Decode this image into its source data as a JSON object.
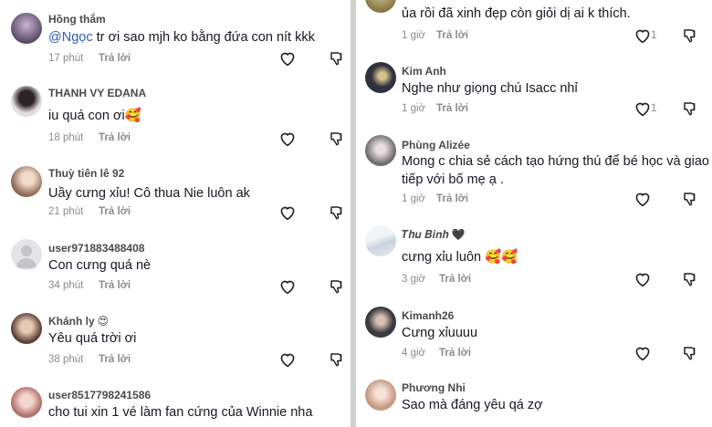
{
  "left_comments": [
    {
      "username": "Hồng thắm",
      "mention": "@Ngọc",
      "text": " tr ơi sao mjh ko bằng đứa con nít kkk",
      "time": "17 phút",
      "reply": "Trả lời",
      "avatar_color": "#5b4a6a"
    },
    {
      "username": "THANH VY EDANA",
      "text": "iu quá con ơi🥰",
      "time": "18 phút",
      "reply": "Trả lời",
      "avatar_color": "#d9d3da"
    },
    {
      "username": "Thuỳ tiên lê 92",
      "text": "Uầy cưng xỉu! Cô thua Nie luôn ak",
      "time": "21 phút",
      "reply": "Trả lời",
      "avatar_color": "#b99a86"
    },
    {
      "username": "user971883488408",
      "text": "Con cưng quá nè",
      "time": "34 phút",
      "reply": "Trả lời",
      "avatar_color": "#d8d8dc"
    },
    {
      "username": "Khánh ly",
      "username_emoji": "😍",
      "text": "Yêu quá trời ơi",
      "time": "38 phút",
      "reply": "Trả lời",
      "avatar_color": "#7a5c52"
    },
    {
      "username": "user8517798241586",
      "text": "cho tui xin 1 vé làm fan cứng của Winnie nha",
      "avatar_color": "#c98f8a"
    }
  ],
  "right_comments": [
    {
      "text": "ủa rồi đã xinh đẹp còn giỏi dị ai k thích.",
      "time": "1 giờ",
      "reply": "Trả lời",
      "likes": "1",
      "avatar_color": "#b8a77a"
    },
    {
      "username": "Kim Anh",
      "text": "Nghe như giọng chú Isacc nhỉ",
      "time": "1 giờ",
      "reply": "Trả lời",
      "likes": "1",
      "avatar_color": "#2f3340"
    },
    {
      "username": "Phùng Alizée",
      "text": "Mong c chia sẻ cách tạo hứng thú để bé học và giao",
      "text2": "tiếp với bố mẹ ạ .",
      "time": "1 giờ",
      "reply": "Trả lời",
      "avatar_color": "#a7a3a8"
    },
    {
      "username": "𝑻𝒉𝒖 𝑩𝒊𝒏𝒉",
      "username_emoji": "🖤",
      "text": "cưng xỉu luôn 🥰🥰",
      "time": "3 giờ",
      "reply": "Trả lời",
      "avatar_color": "#cfd6df"
    },
    {
      "username": "Kimanh26",
      "text": "Cưng xỉuuuu",
      "time": "4 giờ",
      "reply": "Trả lời",
      "avatar_color": "#3b3a3e"
    },
    {
      "username": "Phương Nhi",
      "text": "Sao mà đáng yêu qá zợ",
      "avatar_color": "#e6c8b8"
    }
  ]
}
